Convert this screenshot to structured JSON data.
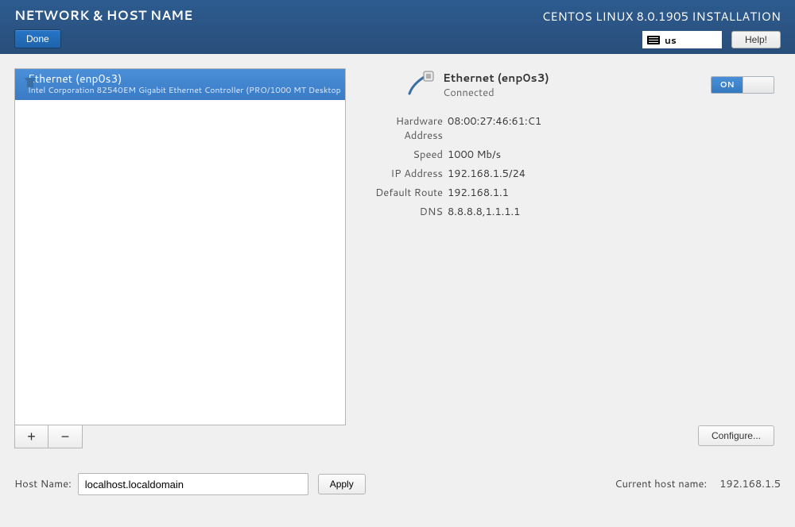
{
  "header": {
    "title": "NETWORK & HOST NAME",
    "done_label": "Done",
    "distro": "CENTOS LINUX 8.0.1905 INSTALLATION",
    "keyboard": "us",
    "help_label": "Help!"
  },
  "interfaces": [
    {
      "name": "Ethernet (enp0s3)",
      "description": "Intel Corporation 82540EM Gigabit Ethernet Controller (PRO/1000 MT Desktop"
    }
  ],
  "connection": {
    "title": "Ethernet (enp0s3)",
    "status": "Connected",
    "toggle": {
      "state": "ON"
    },
    "details": {
      "hardware_address": {
        "label": "Hardware Address",
        "value": "08:00:27:46:61:C1"
      },
      "speed": {
        "label": "Speed",
        "value": "1000 Mb/s"
      },
      "ip_address": {
        "label": "IP Address",
        "value": "192.168.1.5/24"
      },
      "default_route": {
        "label": "Default Route",
        "value": "192.168.1.1"
      },
      "dns": {
        "label": "DNS",
        "value": "8.8.8.8,1.1.1.1"
      }
    }
  },
  "buttons": {
    "add": "+",
    "remove": "−",
    "configure": "Configure...",
    "apply": "Apply"
  },
  "hostname": {
    "label": "Host Name:",
    "value": "localhost.localdomain",
    "current_label": "Current host name:",
    "current_value": "192.168.1.5"
  }
}
